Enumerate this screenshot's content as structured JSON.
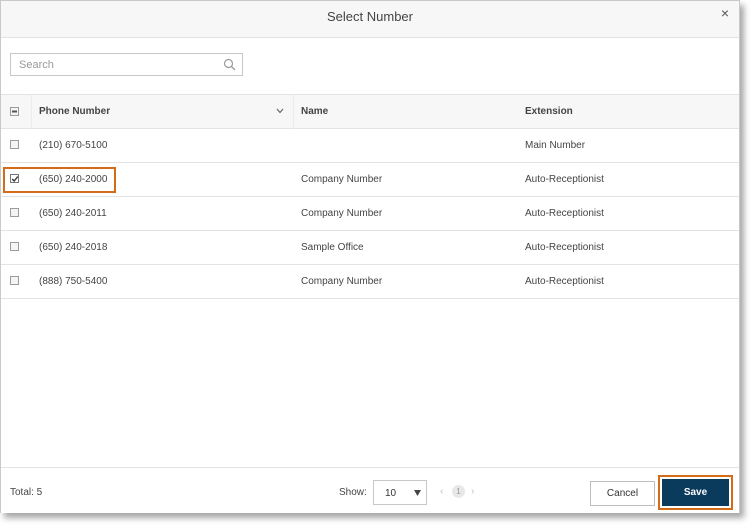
{
  "dialog": {
    "title": "Select Number",
    "close_label": "×"
  },
  "search": {
    "placeholder": "Search",
    "value": ""
  },
  "table": {
    "columns": {
      "phone": "Phone Number",
      "name": "Name",
      "extension": "Extension"
    },
    "rows": [
      {
        "phone": "(210) 670-5100",
        "name": "",
        "extension": "Main Number",
        "checked": false
      },
      {
        "phone": "(650) 240-2000",
        "name": "Company Number",
        "extension": "Auto-Receptionist",
        "checked": true
      },
      {
        "phone": "(650) 240-2011",
        "name": "Company Number",
        "extension": "Auto-Receptionist",
        "checked": false
      },
      {
        "phone": "(650) 240-2018",
        "name": "Sample Office",
        "extension": "Auto-Receptionist",
        "checked": false
      },
      {
        "phone": "(888) 750-5400",
        "name": "Company Number",
        "extension": "Auto-Receptionist",
        "checked": false
      }
    ]
  },
  "footer": {
    "total": "Total: 5",
    "show_label": "Show:",
    "page_size": "10",
    "current_page": "1",
    "prev_label": "‹",
    "next_label": "›",
    "cancel_label": "Cancel",
    "save_label": "Save"
  },
  "colors": {
    "accent": "#0a3a5c",
    "highlight": "#d36b17"
  },
  "icons": {
    "search": "search-icon",
    "close": "close-icon",
    "sort": "chevron-down-icon",
    "dropdown": "caret-down-icon"
  }
}
